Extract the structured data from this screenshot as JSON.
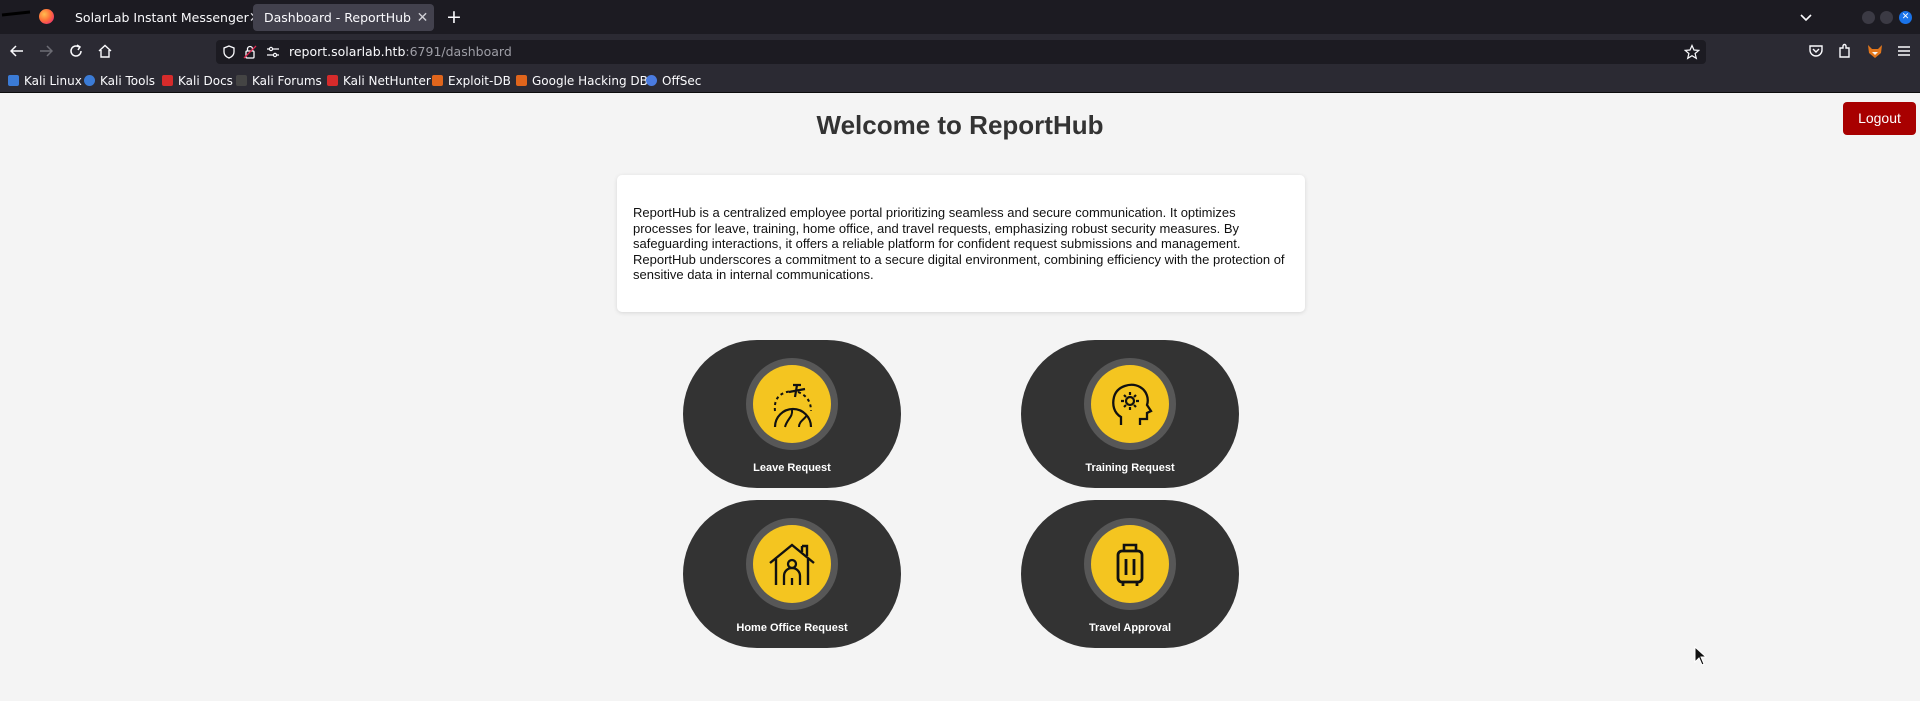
{
  "browser": {
    "tabs": [
      {
        "label": "SolarLab Instant Messenger",
        "active": false
      },
      {
        "label": "Dashboard - ReportHub",
        "active": true
      }
    ],
    "url": {
      "host": "report.solarlab.htb",
      "rest": ":6791/dashboard",
      "prefix": "report."
    },
    "bookmarks": [
      {
        "label": "Kali Linux",
        "color": "#3b7bd6"
      },
      {
        "label": "Kali Tools",
        "color": "#3b7bd6"
      },
      {
        "label": "Kali Docs",
        "color": "#d62b2b"
      },
      {
        "label": "Kali Forums",
        "color": "#444444"
      },
      {
        "label": "Kali NetHunter",
        "color": "#d62b2b"
      },
      {
        "label": "Exploit-DB",
        "color": "#e0651c"
      },
      {
        "label": "Google Hacking DB",
        "color": "#e0651c"
      },
      {
        "label": "OffSec",
        "color": "#4a7be0"
      }
    ]
  },
  "page": {
    "title": "Welcome to ReportHub",
    "logout_label": "Logout",
    "intro": "ReportHub is a centralized employee portal prioritizing seamless and secure communication. It optimizes processes for leave, training, home office, and travel requests, emphasizing robust security measures. By safeguarding interactions, it offers a reliable platform for confident request submissions and management. ReportHub underscores a commitment to a secure digital environment, combining efficiency with the protection of sensitive data in internal communications.",
    "tiles": [
      {
        "label": "Leave Request",
        "icon": "airplane-globe-icon"
      },
      {
        "label": "Training Request",
        "icon": "head-gear-icon"
      },
      {
        "label": "Home Office Request",
        "icon": "house-person-icon"
      },
      {
        "label": "Travel Approval",
        "icon": "luggage-icon"
      }
    ]
  },
  "colors": {
    "accent_yellow": "#f4c520",
    "tile_dark": "#333333",
    "logout_red": "#a80000",
    "page_bg": "#f4f4f4"
  }
}
